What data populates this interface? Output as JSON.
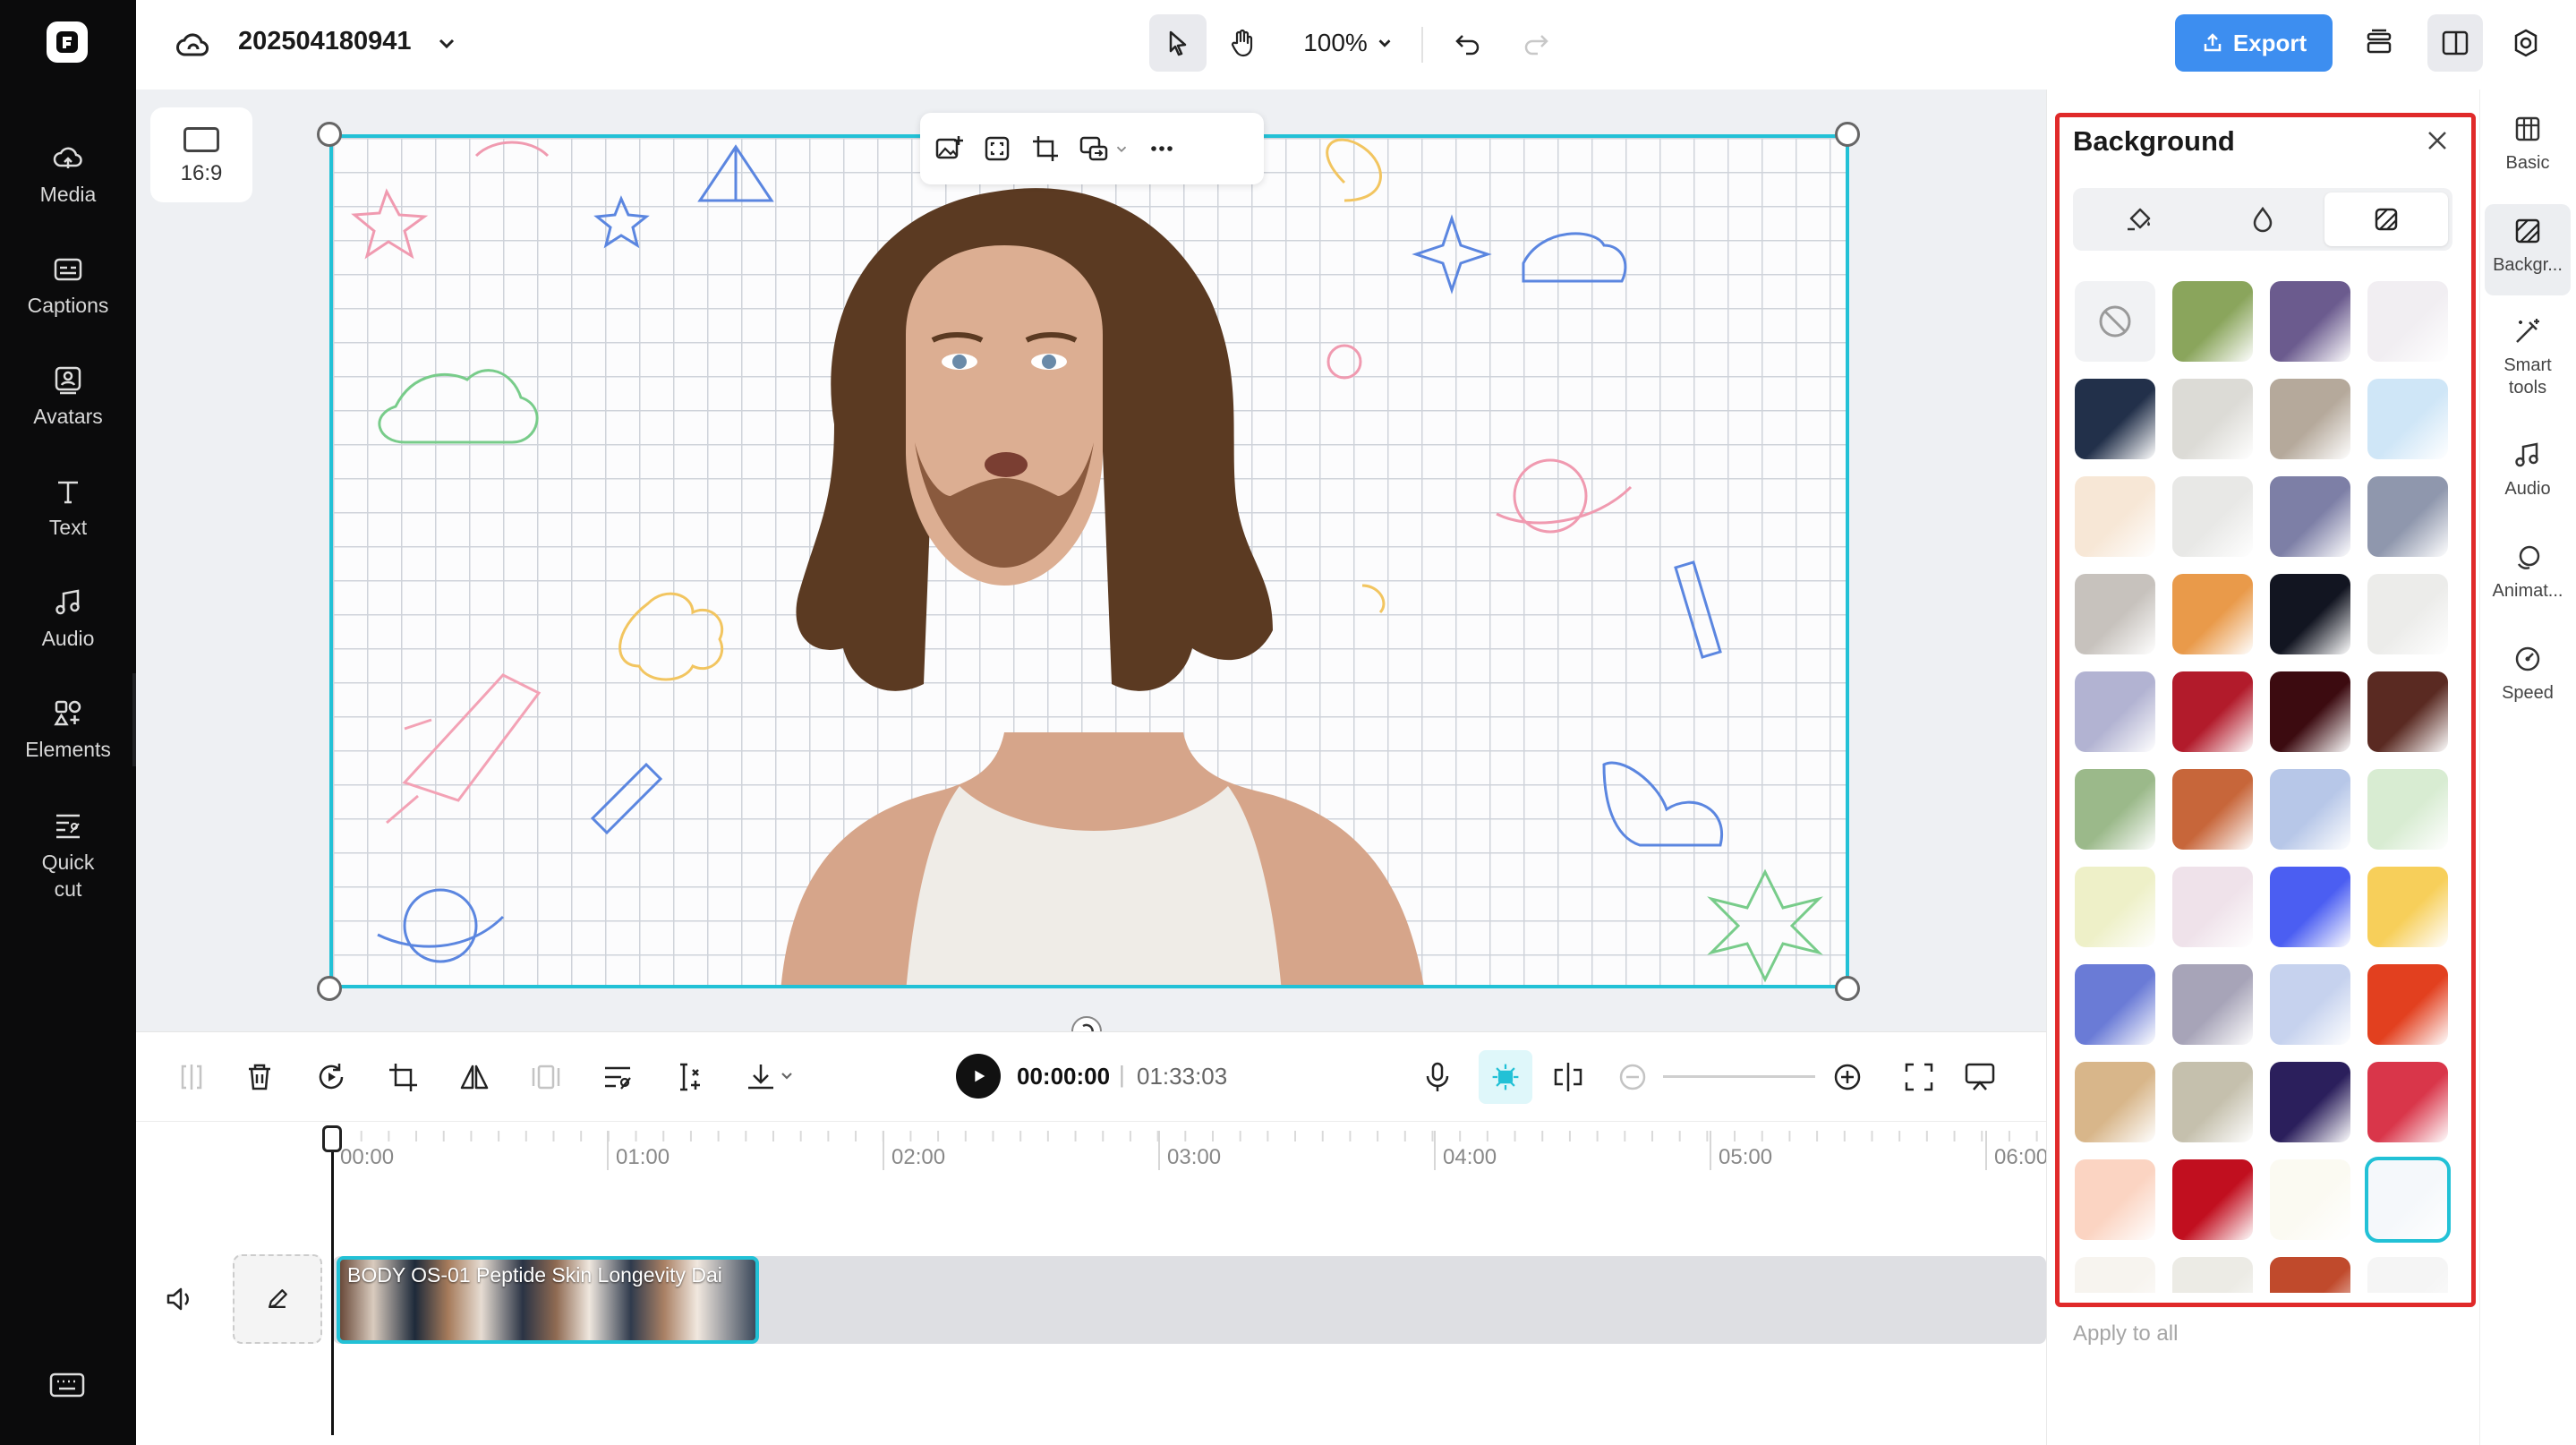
{
  "app": {
    "project_title": "202504180941",
    "zoom": "100%",
    "export_label": "Export"
  },
  "left_rail": {
    "items": [
      {
        "label": "Media",
        "icon": "cloud-upload-icon"
      },
      {
        "label": "Captions",
        "icon": "captions-icon"
      },
      {
        "label": "Avatars",
        "icon": "avatar-icon"
      },
      {
        "label": "Text",
        "icon": "text-icon"
      },
      {
        "label": "Audio",
        "icon": "music-note-icon"
      },
      {
        "label": "Elements",
        "icon": "elements-icon"
      },
      {
        "label": "Quick cut",
        "icon": "quick-cut-icon"
      }
    ]
  },
  "canvas": {
    "aspect_ratio": "16:9"
  },
  "playback": {
    "current_time": "00:00:00",
    "separator": "|",
    "duration": "01:33:03"
  },
  "timeline": {
    "ruler": [
      "00:00",
      "01:00",
      "02:00",
      "03:00",
      "04:00",
      "05:00",
      "06:00"
    ],
    "clip_title": "BODY OS-01 Peptide Skin Longevity Dai"
  },
  "background_panel": {
    "title": "Background",
    "tabs": [
      "fill-bucket-icon",
      "droplet-icon",
      "image-pattern-icon"
    ],
    "active_tab": 2,
    "apply_all_label": "Apply to all",
    "swatch_colors": [
      "none",
      "#8aa55c",
      "#6b5b8e",
      "#f1eef2",
      "#22304a",
      "#dcdbd6",
      "#b5a99b",
      "#cfe6f7",
      "#f7e7d6",
      "#e8e8e6",
      "#7d7fa6",
      "#8f97ad",
      "#c7c2bd",
      "#e99a4a",
      "#121521",
      "#ececea",
      "#b2b3d2",
      "#b21b2b",
      "#3c0b10",
      "#5a2a22",
      "#9bb98a",
      "#c7663a",
      "#b7c7e8",
      "#d8ecd2",
      "#eef0c8",
      "#efe2ea",
      "#4b5ef2",
      "#f7cf5a",
      "#6a7bd6",
      "#a7a4b8",
      "#c6d2ee",
      "#e2401f",
      "#d8b68a",
      "#c5c0ad",
      "#2b1f5c",
      "#d9364a",
      "#fbd4c2",
      "#c10f1f",
      "#fbfaf2",
      "#f5f8fb",
      "#f7f4ef",
      "#ecebe5",
      "#c04a2c",
      "#f5f5f5"
    ]
  },
  "right_rail": {
    "items": [
      {
        "label": "Basic",
        "icon": "basic-icon"
      },
      {
        "label": "Backgr...",
        "icon": "background-icon"
      },
      {
        "label": "Smart tools",
        "icon": "magic-wand-icon"
      },
      {
        "label": "Audio",
        "icon": "music-note-icon"
      },
      {
        "label": "Animat...",
        "icon": "animation-icon"
      },
      {
        "label": "Speed",
        "icon": "speed-icon"
      }
    ],
    "active_index": 1
  },
  "colors": {
    "accent": "#22c1d6",
    "export_blue": "#3d8ef0",
    "highlight_red": "#e02a2a"
  }
}
